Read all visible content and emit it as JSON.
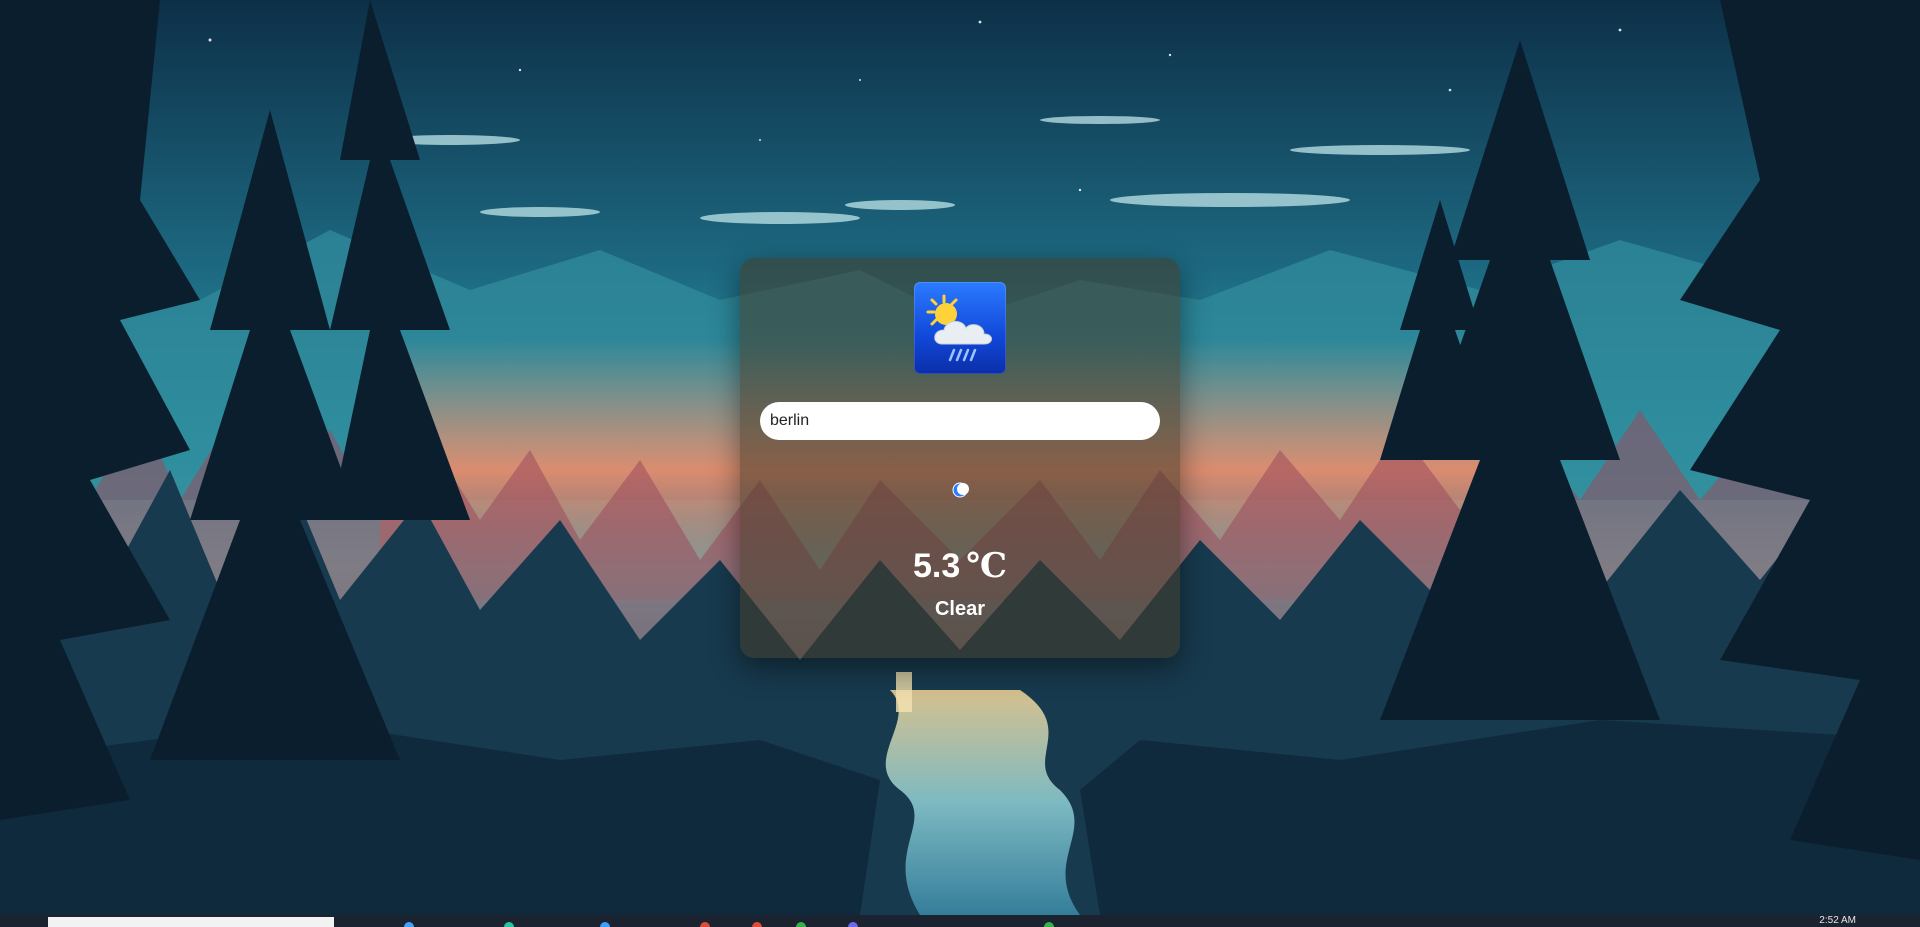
{
  "search": {
    "value": "berlin",
    "placeholder": ""
  },
  "weather": {
    "temperature": "5.3",
    "unit": "℃",
    "condition": "Clear",
    "condition_icon": "crescent-moon-icon"
  },
  "logo": {
    "icon": "weather-app-logo-sun-cloud-rain"
  },
  "taskbar": {
    "clock": "2:52 AM"
  },
  "colors": {
    "card_background": "#463a28",
    "logo_blue": "#1147d8",
    "sky_teal": "#1f7f92",
    "forest_navy": "#0f2236",
    "sunset_orange": "#e88a5c"
  }
}
